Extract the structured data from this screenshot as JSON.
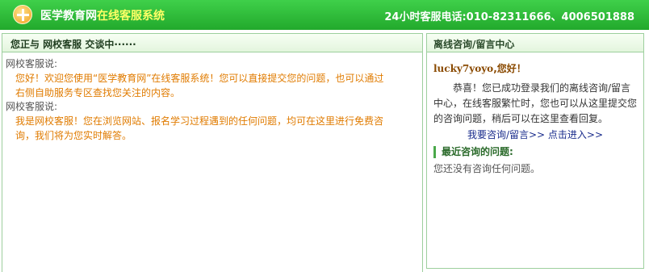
{
  "header": {
    "title_part1": "医学教育网",
    "title_part2": "在线客服系统",
    "hotline": "24小时客服电话:010-82311666、4006501888"
  },
  "chat_panel": {
    "title": "您正与  网校客服  交谈中······",
    "messages": [
      {
        "sender": "网校客服说:",
        "text": "您好！欢迎您使用“医学教育网”在线客服系统！您可以直接提交您的问题，也可以通过右侧自助服务专区查找您关注的内容。"
      },
      {
        "sender": "网校客服说:",
        "text": "我是网校客服！您在浏览网站、报名学习过程遇到的任何问题，均可在这里进行免费咨询，我们将为您实时解答。"
      }
    ]
  },
  "offline_panel": {
    "title": "离线咨询/留言中心",
    "username": "lucky7yoyo",
    "greeting_suffix": ",您好！",
    "notice": "恭喜！您已成功登录我们的离线咨询/留言中心，在线客服繁忙时，您也可以从这里提交您的咨询问题，稍后可以在这里查看回复。",
    "link_text": "我要咨询/留言>> 点击进入>>",
    "recent_title": "最近咨询的问题:",
    "recent_empty": "您还没有咨询任何问题。"
  }
}
